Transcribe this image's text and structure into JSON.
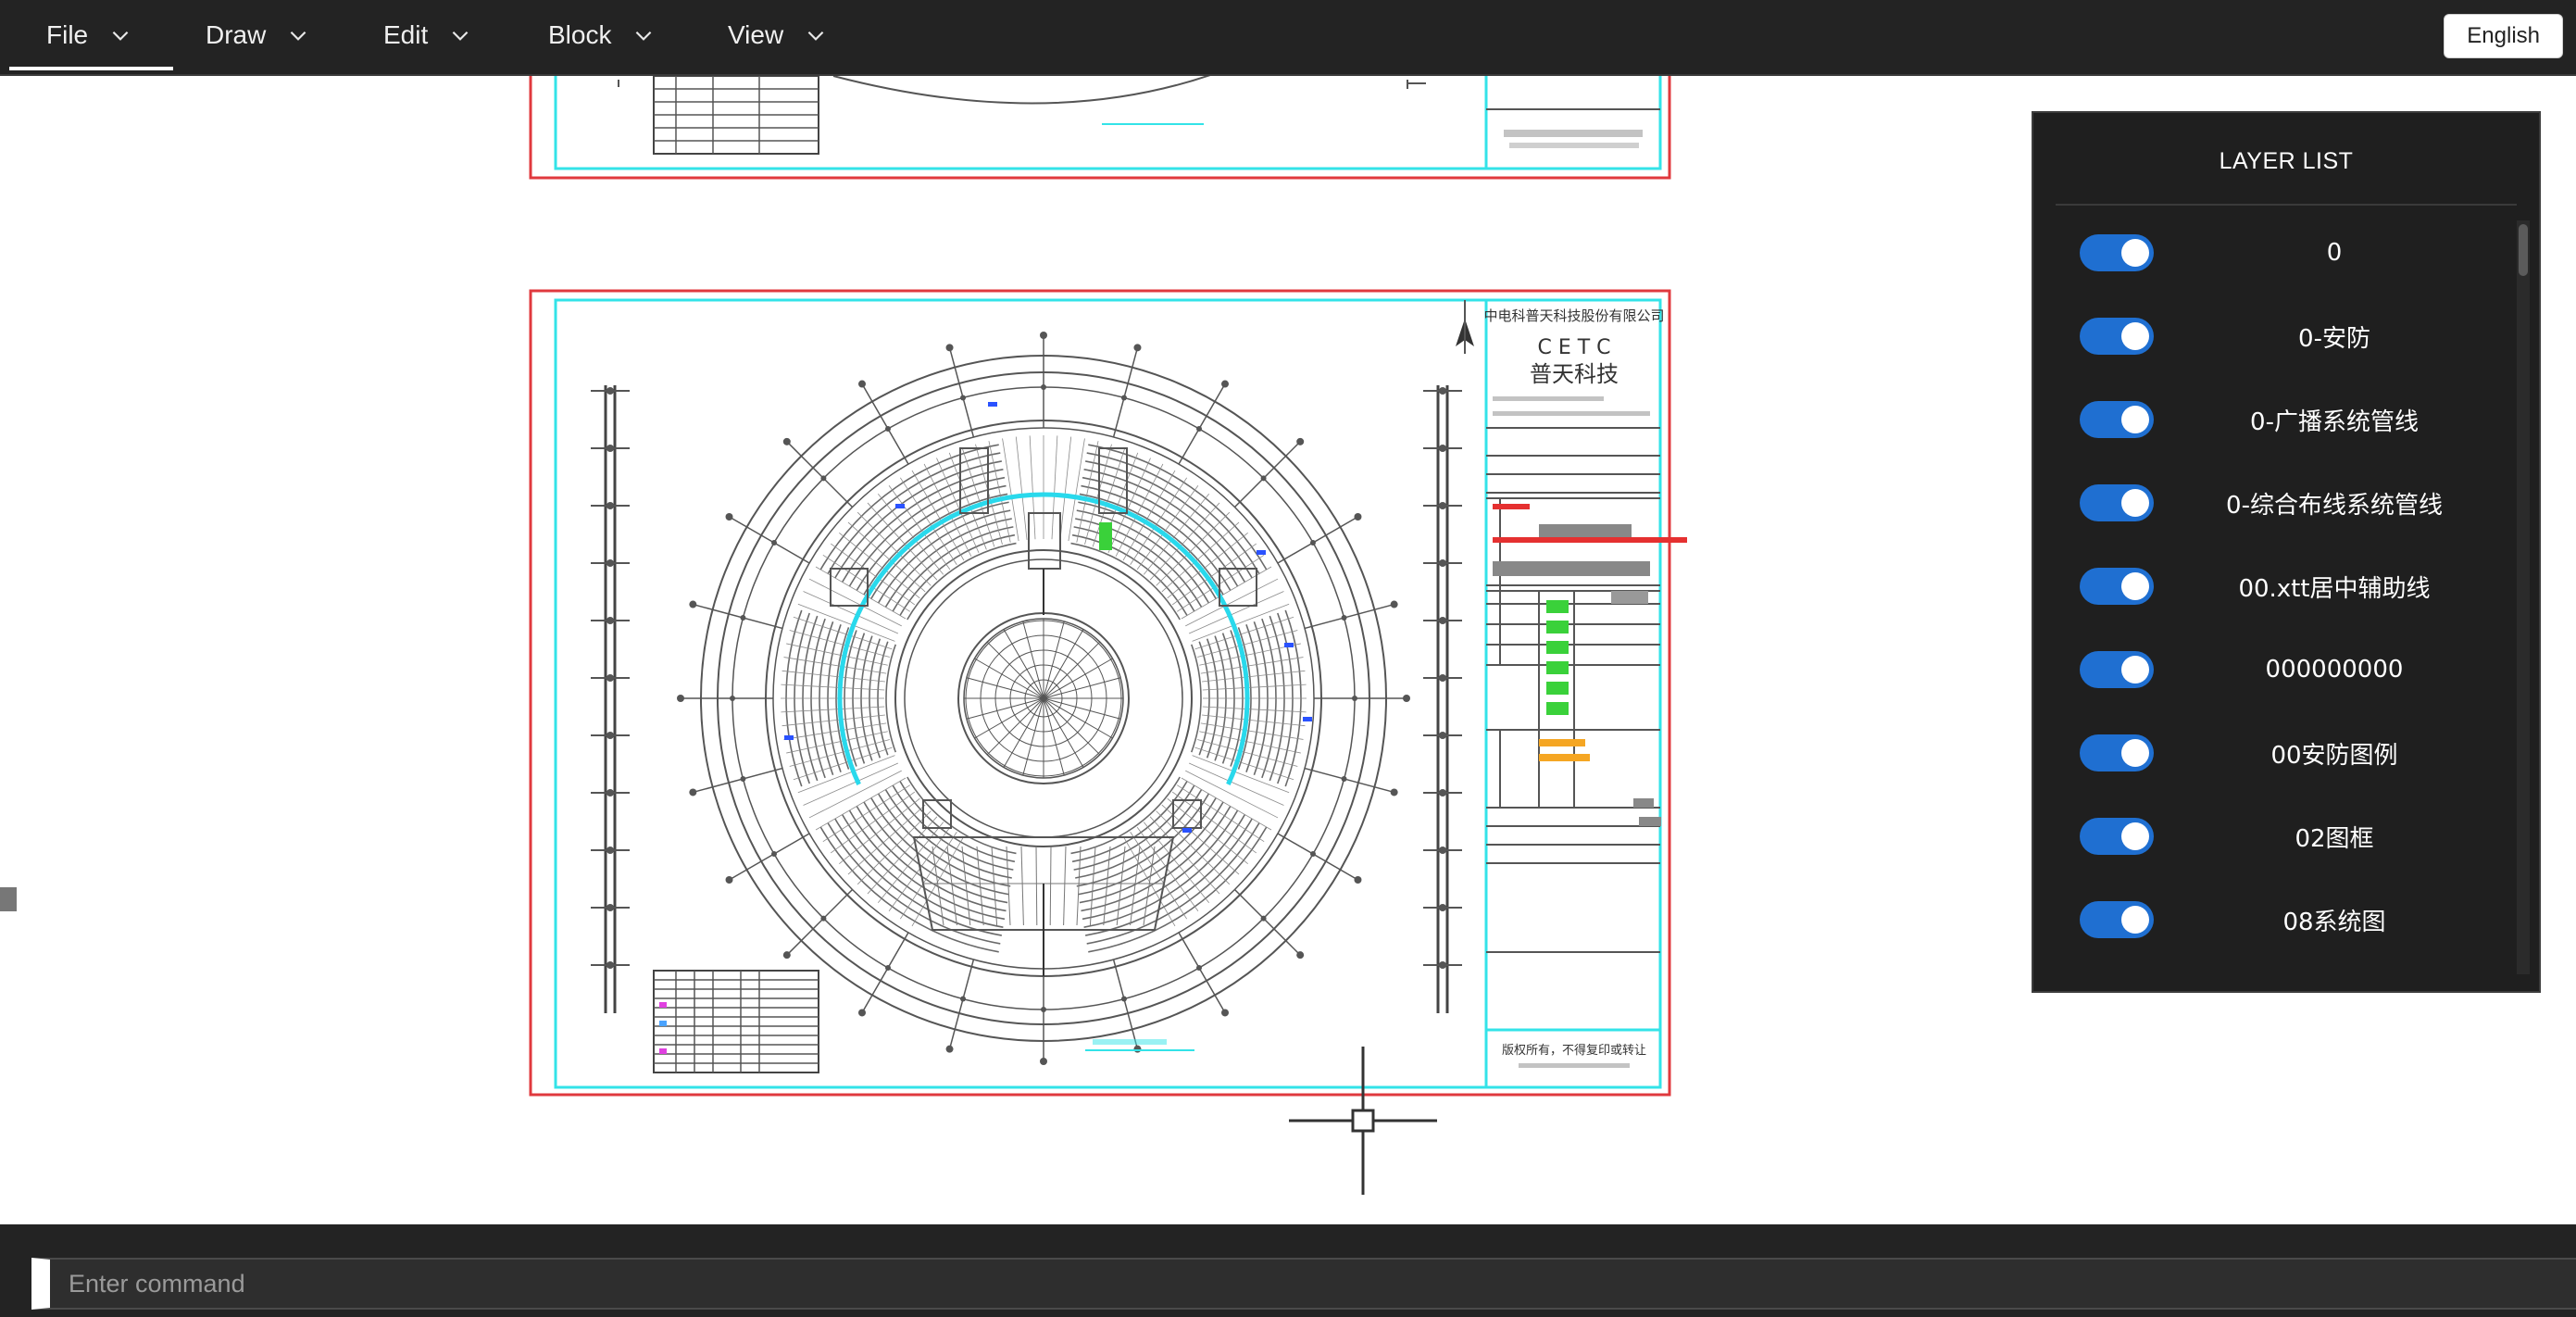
{
  "menu": {
    "items": [
      {
        "label": "File",
        "active": true
      },
      {
        "label": "Draw",
        "active": false
      },
      {
        "label": "Edit",
        "active": false
      },
      {
        "label": "Block",
        "active": false
      },
      {
        "label": "View",
        "active": false
      }
    ],
    "language_button": "English"
  },
  "drawing": {
    "title_block": {
      "company": "中电科普天科技股份有限公司",
      "logo_text": "C E T C",
      "logo_subtext": "普天科技",
      "footer_note": "版权所有，不得复印或转让"
    },
    "colors": {
      "frame": "#e0393e",
      "inner_frame": "#33e3e8",
      "lines": "#555555",
      "highlight_ring": "#29d9ec"
    }
  },
  "layer_panel": {
    "title": "LAYER LIST",
    "layers": [
      {
        "name": "0",
        "on": true
      },
      {
        "name": "0-安防",
        "on": true
      },
      {
        "name": "0-广播系统管线",
        "on": true
      },
      {
        "name": "0-综合布线系统管线",
        "on": true
      },
      {
        "name": "00.xtt居中辅助线",
        "on": true
      },
      {
        "name": "000000000",
        "on": true
      },
      {
        "name": "00安防图例",
        "on": true
      },
      {
        "name": "02图框",
        "on": true
      },
      {
        "name": "08系统图",
        "on": true
      }
    ],
    "toggle_color": "#1f6fd1"
  },
  "command": {
    "placeholder": "Enter command"
  }
}
